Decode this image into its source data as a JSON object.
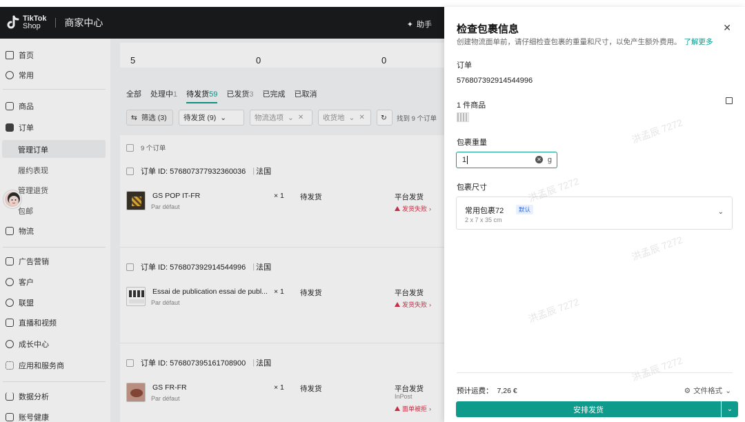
{
  "header": {
    "logo_text_1": "TikTok",
    "logo_text_2": "Shop",
    "title": "商家中心",
    "assistant_label": "助手"
  },
  "sidebar": {
    "items": [
      {
        "label": "首页",
        "icon": "home-icon"
      },
      {
        "label": "常用",
        "icon": "star-icon"
      },
      {
        "label": "商品",
        "icon": "product-icon"
      },
      {
        "label": "订单",
        "icon": "order-icon"
      },
      {
        "label": "物流",
        "icon": "truck-icon"
      },
      {
        "label": "广告营销",
        "icon": "megaphone-icon"
      },
      {
        "label": "客户",
        "icon": "customer-icon"
      },
      {
        "label": "联盟",
        "icon": "affiliate-icon"
      },
      {
        "label": "直播和视频",
        "icon": "live-icon"
      },
      {
        "label": "成长中心",
        "icon": "growth-icon"
      },
      {
        "label": "应用和服务商",
        "icon": "apps-icon"
      },
      {
        "label": "数据分析",
        "icon": "analytics-icon"
      },
      {
        "label": "账号健康",
        "icon": "trophy-icon"
      }
    ],
    "sub_items": [
      "管理订单",
      "履约表现",
      "管理退货",
      "包邮"
    ]
  },
  "stats": [
    "5",
    "0",
    "0"
  ],
  "tabs": [
    {
      "label": "全部",
      "count": ""
    },
    {
      "label": "处理中",
      "count": "1"
    },
    {
      "label": "待发货",
      "count": "59"
    },
    {
      "label": "已发货",
      "count": "3"
    },
    {
      "label": "已完成",
      "count": ""
    },
    {
      "label": "已取消",
      "count": ""
    }
  ],
  "filters": {
    "filter_btn": "筛选 (3)",
    "status": "待发货 (9)",
    "logistics": "物流选项",
    "region": "收货地",
    "found": "找到 9 个订单"
  },
  "list_header": "9 个订单",
  "orders": [
    {
      "id": "订单 ID: 576807377932360036",
      "country": "法国",
      "product": "GS POP IT-FR",
      "variant": "Par défaut",
      "qty": "× 1",
      "status": "待发货",
      "ship": "平台发货",
      "extra": "",
      "fail": "发货失败"
    },
    {
      "id": "订单 ID: 576807392914544996",
      "country": "法国",
      "product": "Essai de publication essai de publ...",
      "variant": "Par défaut",
      "qty": "× 1",
      "status": "待发货",
      "ship": "平台发货",
      "extra": "",
      "fail": "发货失败"
    },
    {
      "id": "订单 ID: 576807395161708900",
      "country": "法国",
      "product": "GS FR-FR",
      "variant": "Par défaut",
      "qty": "× 1",
      "status": "待发货",
      "ship": "平台发货",
      "extra": "InPost",
      "fail": "面单被拒"
    }
  ],
  "drawer": {
    "title": "检查包裹信息",
    "description": "创建物流面单前，请仔细检查包裹的重量和尺寸，以免产生额外费用。",
    "learn_more": "了解更多",
    "order_label": "订单",
    "order_id": "576807392914544996",
    "items_label": "1 件商品",
    "weight_label": "包裹重量",
    "weight_value": "1",
    "weight_unit": "g",
    "dims_label": "包裹尺寸",
    "package_name": "常用包裹72",
    "package_tag": "默认",
    "package_dims": "2 x 7 x 35 cm",
    "fee_label": "预计运费：",
    "fee_value": "7,26 €",
    "file_format": "文件格式",
    "ship_button": "安排发货"
  },
  "watermark": "洪孟辰 7272",
  "colors": {
    "accent": "#0e9b8c",
    "error": "#d9304a",
    "topbar": "#1b1c1e"
  }
}
